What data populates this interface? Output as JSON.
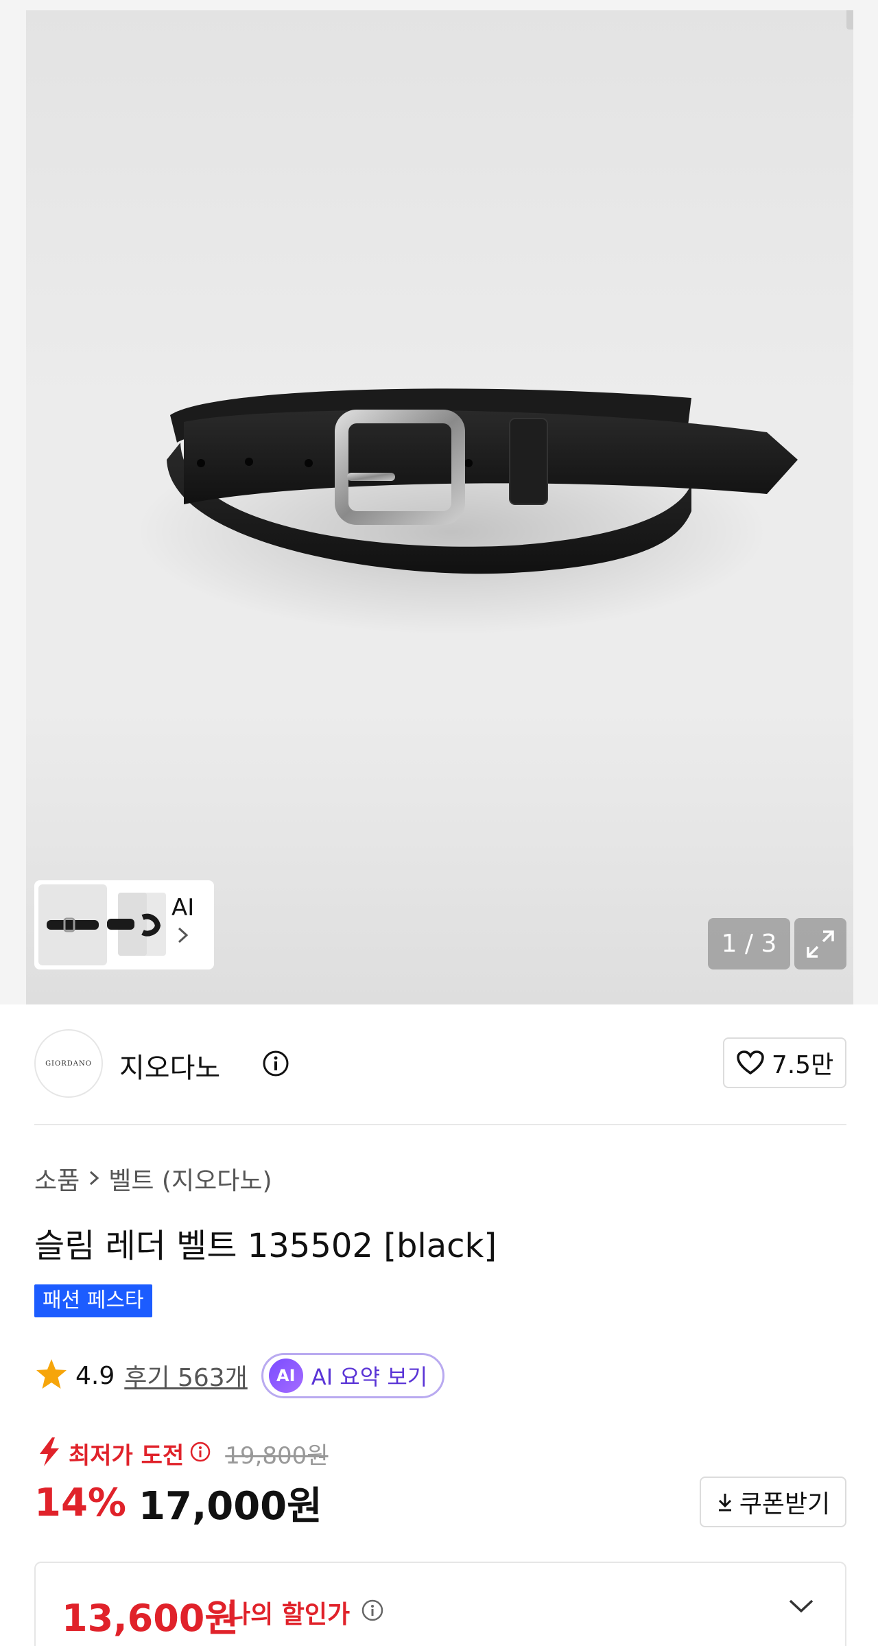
{
  "gallery": {
    "counter": "1 / 3",
    "ai_label": "AI",
    "product_image": "black leather slim belt with silver buckle"
  },
  "brand": {
    "logo_text": "GIORDANO",
    "name": "지오다노",
    "like_count": "7.5만"
  },
  "breadcrumb": {
    "parent": "소품",
    "current": "벨트 (지오다노)"
  },
  "product": {
    "title": "슬림 레더 벨트 135502 [black]",
    "badge": "패션 페스타"
  },
  "rating": {
    "score": "4.9",
    "reviews": "후기 563개",
    "ai_badge": "AI",
    "ai_summary": "AI 요약 보기"
  },
  "pricing": {
    "challenge_label": "최저가 도전",
    "original_price": "19,800원",
    "discount": "14%",
    "price": "17,000원",
    "coupon_label": "쿠폰받기",
    "my_price": "13,600원",
    "my_price_label": "나의 할인가"
  },
  "colors": {
    "sale_red": "#e0222a",
    "badge_blue": "#1c5cff",
    "ai_purple": "#7b4dff"
  }
}
